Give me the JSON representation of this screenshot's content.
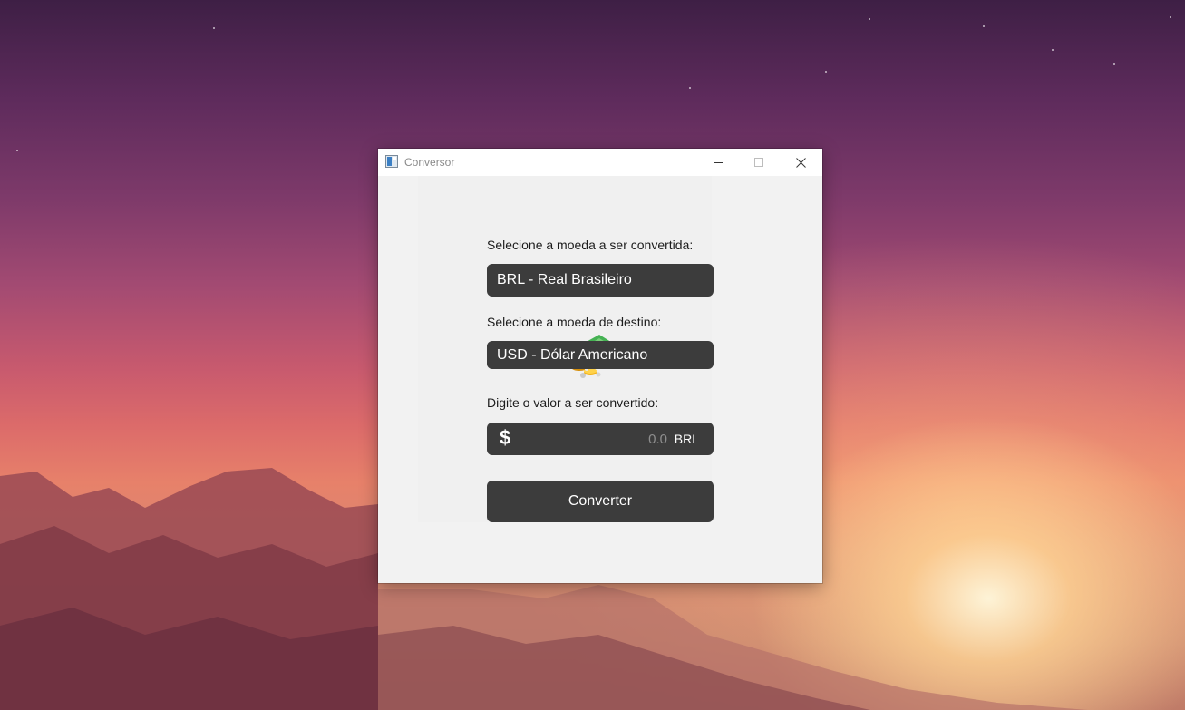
{
  "window": {
    "title": "Conversor",
    "controls": {
      "minimize": "minimize-icon",
      "maximize": "maximize-icon",
      "close": "close-icon"
    }
  },
  "icons": {
    "app": "app-window-icon",
    "money": "money-stack-icon",
    "currency": "dollar-sign-icon"
  },
  "form": {
    "source_label": "Selecione a moeda a ser convertida:",
    "source_value": "BRL - Real Brasileiro",
    "target_label": "Selecione a moeda de destino:",
    "target_value": "USD - Dólar Americano",
    "amount_label": "Digite o valor a ser convertido:",
    "amount_symbol": "$",
    "amount_value": "0.0",
    "amount_currency": "BRL",
    "convert_label": "Converter"
  },
  "colors": {
    "field_bg": "#3c3c3c",
    "window_bg": "#f2f2f2",
    "text": "#1c1c1c",
    "money_green": "#3aa14a",
    "coin_gold": "#f3b51b"
  }
}
